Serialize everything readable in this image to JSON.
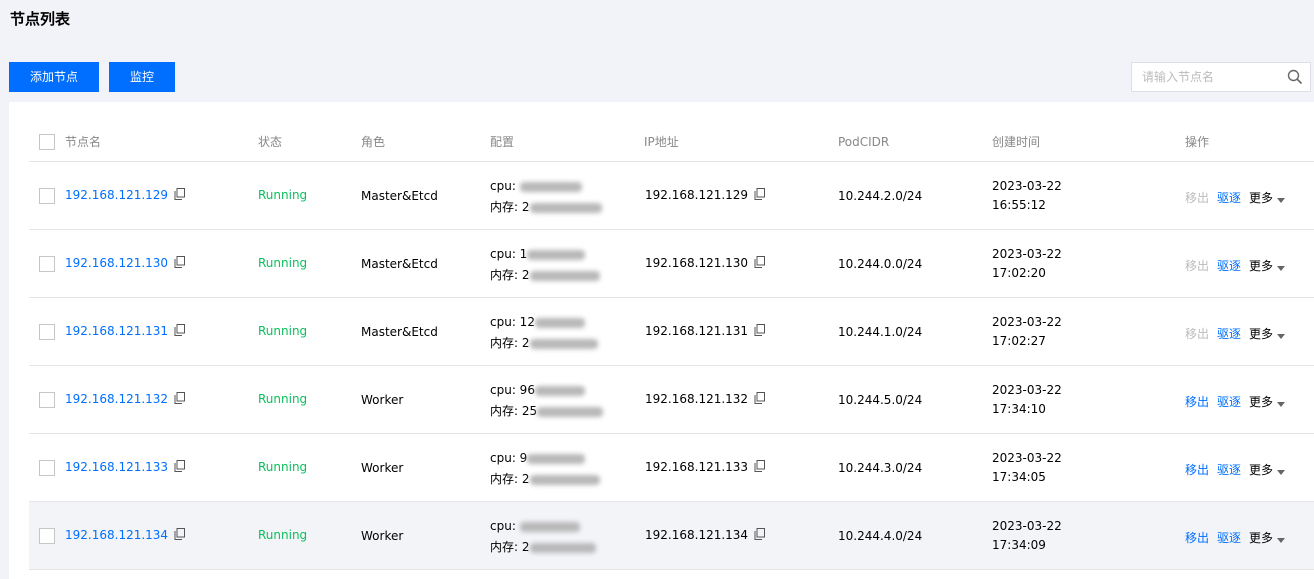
{
  "page": {
    "title": "节点列表"
  },
  "toolbar": {
    "add_label": "添加节点",
    "monitor_label": "监控",
    "search_placeholder": "请输入节点名"
  },
  "table": {
    "columns": [
      "节点名",
      "状态",
      "角色",
      "配置",
      "IP地址",
      "PodCIDR",
      "创建时间",
      "操作"
    ],
    "rows": [
      {
        "name": "192.168.121.129",
        "status": "Running",
        "role": "Master&Etcd",
        "cpu": "cpu: ",
        "mem": "内存: 2",
        "ip": "192.168.121.129",
        "cidr": "10.244.2.0/24",
        "date": "2023-03-22",
        "time": "16:55:12",
        "remove": "移出",
        "remove_enabled": false,
        "evict": "驱逐",
        "more": "更多"
      },
      {
        "name": "192.168.121.130",
        "status": "Running",
        "role": "Master&Etcd",
        "cpu": "cpu: 1",
        "mem": "内存: 2",
        "ip": "192.168.121.130",
        "cidr": "10.244.0.0/24",
        "date": "2023-03-22",
        "time": "17:02:20",
        "remove": "移出",
        "remove_enabled": false,
        "evict": "驱逐",
        "more": "更多"
      },
      {
        "name": "192.168.121.131",
        "status": "Running",
        "role": "Master&Etcd",
        "cpu": "cpu: 12",
        "mem": "内存: 2",
        "ip": "192.168.121.131",
        "cidr": "10.244.1.0/24",
        "date": "2023-03-22",
        "time": "17:02:27",
        "remove": "移出",
        "remove_enabled": false,
        "evict": "驱逐",
        "more": "更多"
      },
      {
        "name": "192.168.121.132",
        "status": "Running",
        "role": "Worker",
        "cpu": "cpu: 96",
        "mem": "内存: 25",
        "ip": "192.168.121.132",
        "cidr": "10.244.5.0/24",
        "date": "2023-03-22",
        "time": "17:34:10",
        "remove": "移出",
        "remove_enabled": true,
        "evict": "驱逐",
        "more": "更多"
      },
      {
        "name": "192.168.121.133",
        "status": "Running",
        "role": "Worker",
        "cpu": "cpu: 9",
        "mem": "内存: 2",
        "ip": "192.168.121.133",
        "cidr": "10.244.3.0/24",
        "date": "2023-03-22",
        "time": "17:34:05",
        "remove": "移出",
        "remove_enabled": true,
        "evict": "驱逐",
        "more": "更多"
      },
      {
        "name": "192.168.121.134",
        "status": "Running",
        "role": "Worker",
        "cpu": "cpu: ",
        "mem": "内存: 2",
        "ip": "192.168.121.134",
        "cidr": "10.244.4.0/24",
        "date": "2023-03-22",
        "time": "17:34:09",
        "remove": "移出",
        "remove_enabled": true,
        "evict": "驱逐",
        "more": "更多",
        "highlighted": true
      }
    ]
  },
  "colors": {
    "primary": "#006eff",
    "running": "#0abf5b",
    "disabled": "#bbbbbb"
  }
}
